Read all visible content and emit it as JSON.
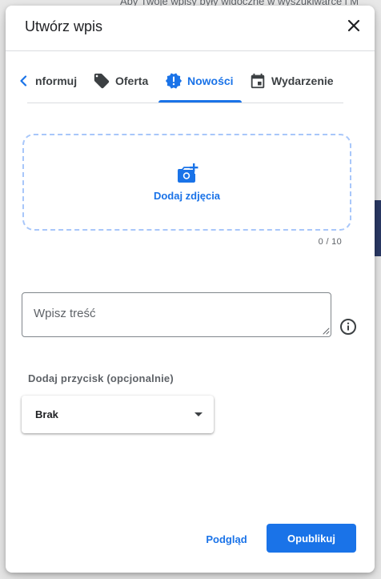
{
  "background": {
    "text": "Aby Twoje wpisy były widoczne w wyszukiwarce i M"
  },
  "dialog": {
    "title": "Utwórz wpis",
    "close_icon": "close-icon"
  },
  "tabs": {
    "chevron_icon": "chevron-left-icon",
    "items": [
      {
        "label": "nformuj",
        "icon": "none",
        "active": false
      },
      {
        "label": "Oferta",
        "icon": "tag-icon",
        "active": false
      },
      {
        "label": "Nowości",
        "icon": "new-releases-icon",
        "active": true
      },
      {
        "label": "Wydarzenie",
        "icon": "calendar-icon",
        "active": false
      }
    ]
  },
  "photos": {
    "label": "Dodaj zdjęcia",
    "icon": "add-photo-icon",
    "count": "0 / 10"
  },
  "post": {
    "placeholder": "Wpisz treść",
    "value": "",
    "info_icon": "info-icon"
  },
  "cta": {
    "label": "Dodaj przycisk (opcjonalnie)",
    "selected": "Brak"
  },
  "actions": {
    "preview": "Podgląd",
    "publish": "Opublikuj"
  },
  "colors": {
    "accent": "#1a73e8",
    "dashed_border": "#a8c7fa",
    "text": "#202124",
    "muted": "#5f6368"
  }
}
